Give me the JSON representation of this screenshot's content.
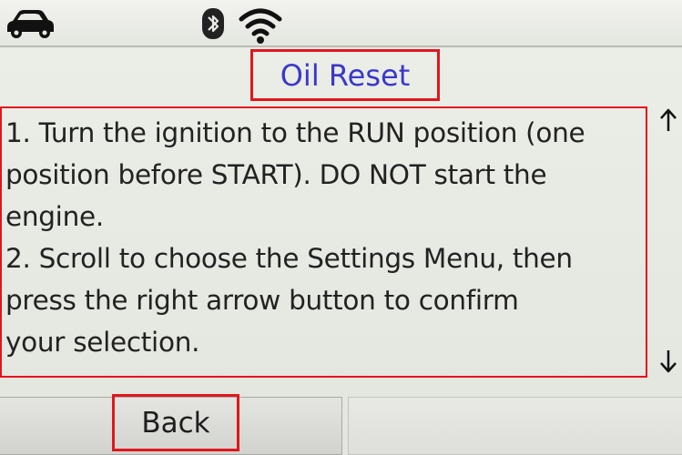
{
  "status_bar": {
    "icons": [
      "car-icon",
      "bluetooth-icon",
      "wifi-icon"
    ]
  },
  "title": "Oil Reset",
  "instructions": {
    "lines": [
      "1. Turn the ignition to the RUN position (one",
      "position before START). DO NOT start the",
      "engine.",
      "2. Scroll to choose the Settings Menu, then",
      "press the right arrow button to confirm",
      "your selection."
    ]
  },
  "scroll": {
    "up_icon": "arrow-up-icon",
    "down_icon": "arrow-down-icon"
  },
  "softkeys": {
    "left_label": "Back",
    "right_label": ""
  },
  "colors": {
    "highlight_border": "#e1161d",
    "title_text": "#3a38c8",
    "screen_background": "#e7e8e2"
  }
}
